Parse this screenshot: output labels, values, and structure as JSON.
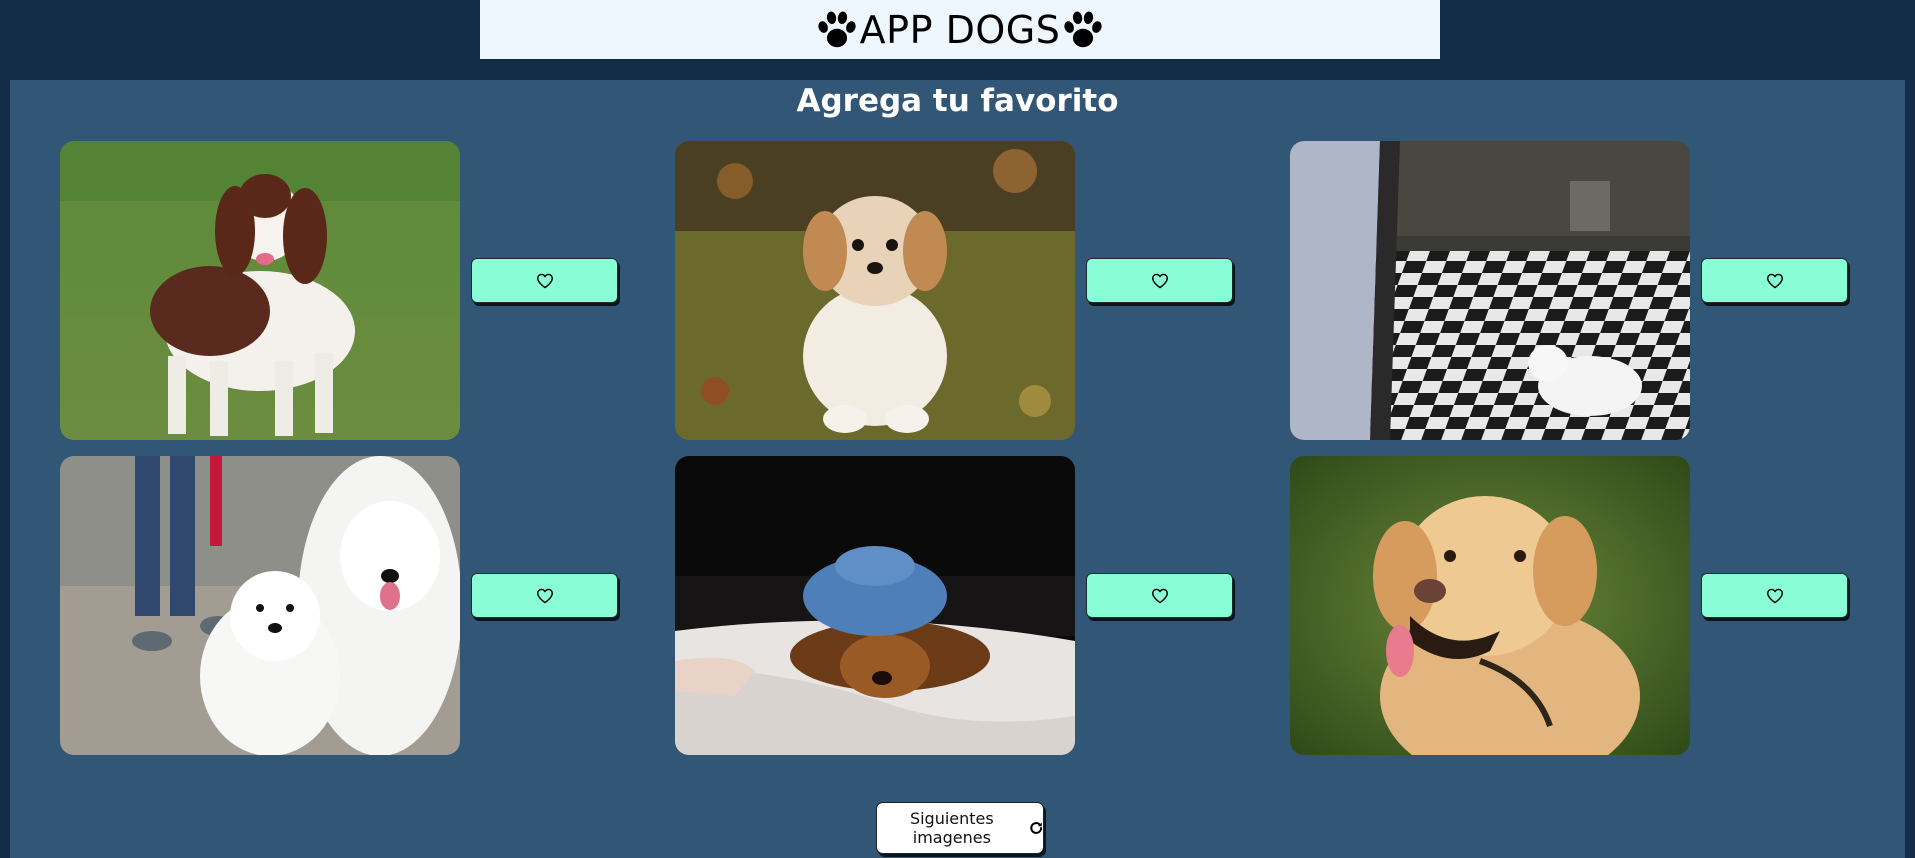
{
  "header": {
    "title": "APP DOGS",
    "left_icon": "paw-icon",
    "right_icon": "paw-icon",
    "background": "#eff7fe"
  },
  "main": {
    "title": "Agrega tu favorito",
    "background": "#325675",
    "cards": [
      {
        "image": "brown-white-spaniel-on-grass",
        "button_icon": "heart-icon"
      },
      {
        "image": "fluffy-puppy-sitting-on-leaves",
        "button_icon": "heart-icon"
      },
      {
        "image": "white-dog-on-checkered-floor",
        "button_icon": "heart-icon"
      },
      {
        "image": "two-samoyeds-on-leash",
        "button_icon": "heart-icon"
      },
      {
        "image": "dog-wearing-knit-hat-in-bed",
        "button_icon": "heart-icon"
      },
      {
        "image": "golden-retriever-portrait",
        "button_icon": "heart-icon"
      }
    ],
    "favorite_button_color": "#89fed6"
  },
  "footer": {
    "next_label": "Siguientes imagenes",
    "next_icon": "refresh-icon"
  }
}
